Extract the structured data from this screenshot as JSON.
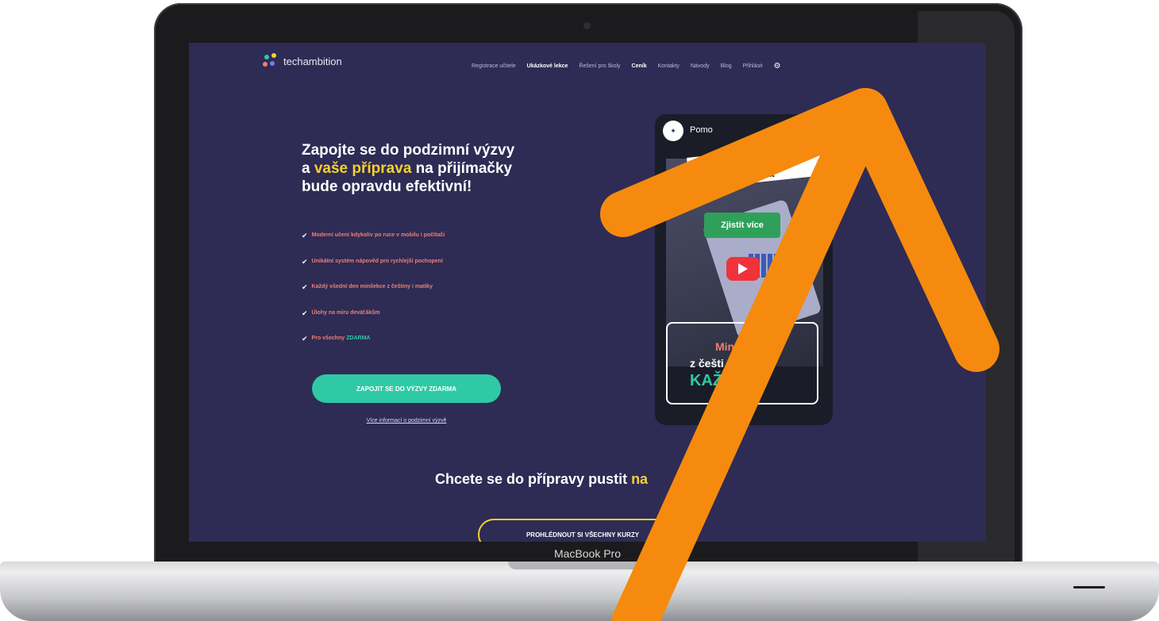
{
  "device": {
    "model_label": "MacBook Pro"
  },
  "site": {
    "logo_text": "techambition",
    "nav": [
      {
        "label": "Registrace učitele",
        "bold": false
      },
      {
        "label": "Ukázkové lekce",
        "bold": true
      },
      {
        "label": "Řešení pro školy",
        "bold": false
      },
      {
        "label": "Ceník",
        "bold": true
      },
      {
        "label": "Kontakty",
        "bold": false
      },
      {
        "label": "Návody",
        "bold": false
      },
      {
        "label": "Blog",
        "bold": false
      },
      {
        "label": "Přihlásit",
        "bold": false
      }
    ],
    "settings_icon": "gear-icon"
  },
  "hero": {
    "title_line1": "Zapojte se do podzimní výzvy",
    "title_line2_prefix": "a ",
    "title_line2_highlight": "vaše příprava",
    "title_line2_suffix": " na přijímačky",
    "title_line3": "bude opravdu efektivní!",
    "checklist": [
      "Moderní učení kdykoliv po ruce v mobilu i počítači",
      "Unikátní systém nápověd pro rychlejší pochopení",
      "Každý všední den minilekce z češtiny i matiky",
      "Úlohy na míru deváťákům"
    ],
    "checklist_last_prefix": "Pro všechny ",
    "checklist_last_highlight": "ZDARMA",
    "cta_label": "ZAPOJIT SE DO VÝZVY ZDARMA",
    "more_link": "Více informací o podzimní výzvě"
  },
  "video": {
    "title": "Pomo",
    "badge": "ýzva",
    "button": "Zjistit více",
    "box_line1": "Mini",
    "box_line2": "z češti",
    "box_line3": "KAŽ        N"
  },
  "bottom": {
    "heading_prefix": "Chcete se do přípravy pustit ",
    "heading_highlight": "na",
    "outline_button": "PROHLÉDNOUT SI VŠECHNY KURZY"
  },
  "colors": {
    "page_bg": "#2e2b55",
    "accent_yellow": "#f5d12f",
    "accent_green": "#2fc9a6",
    "accent_coral": "#f07f6f",
    "arrow_orange": "#f68a0e"
  }
}
